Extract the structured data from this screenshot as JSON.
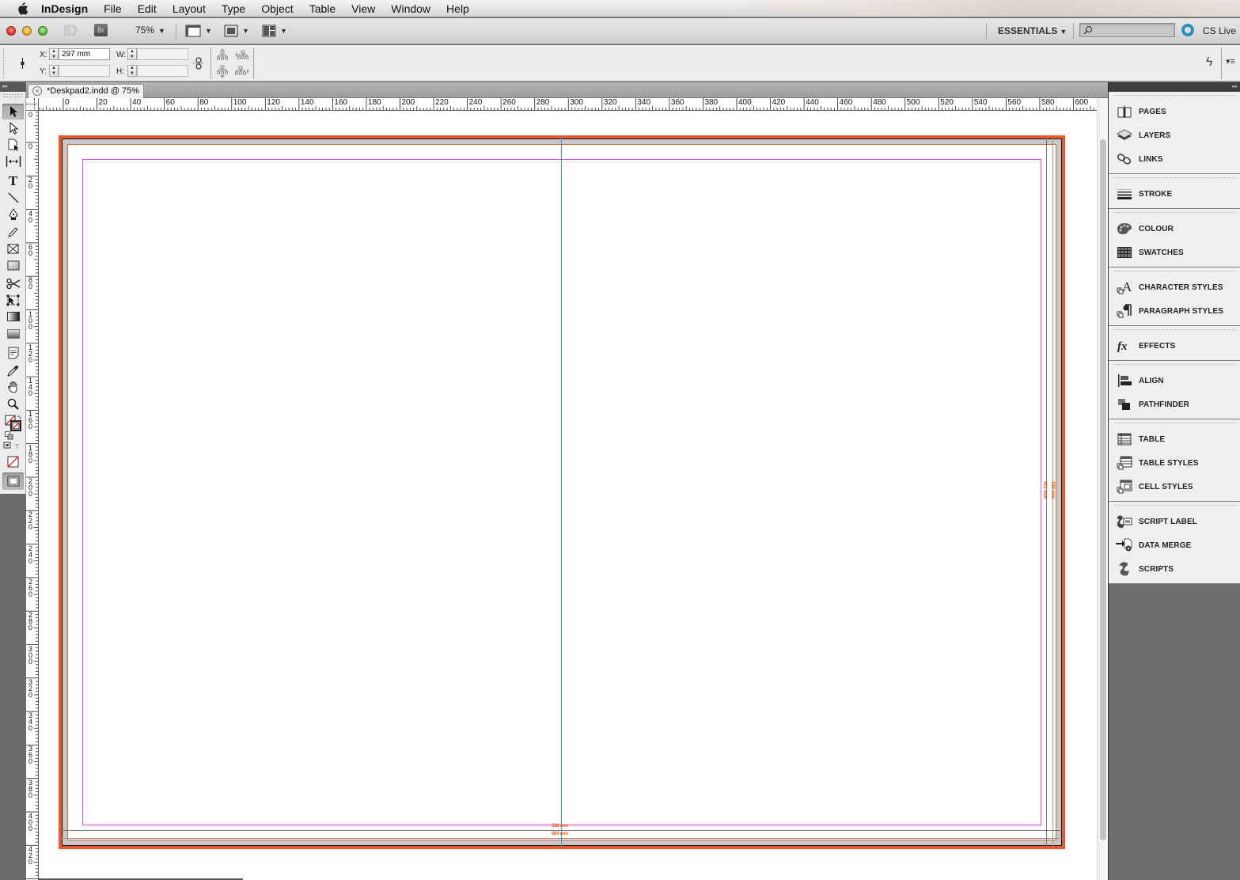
{
  "menubar": {
    "app_name": "InDesign",
    "items": [
      "File",
      "Edit",
      "Layout",
      "Type",
      "Object",
      "Table",
      "View",
      "Window",
      "Help"
    ]
  },
  "appbar": {
    "bridge_label": "Br",
    "zoom_level": "75%",
    "workspace": "ESSENTIALS",
    "search_placeholder": "",
    "cs_live": "CS Live"
  },
  "controlbar": {
    "x_label": "X:",
    "x_value": "297 mm",
    "y_label": "Y:",
    "y_value": "",
    "w_label": "W:",
    "w_value": "",
    "h_label": "H:",
    "h_value": ""
  },
  "document": {
    "tab_title": "*Deskpad2.indd @ 75%",
    "width_label_inner": "568 mm",
    "width_label_outer": "594 mm",
    "height_label_inner": "401 mm",
    "height_label_outer": "420 mm"
  },
  "rulers": {
    "horizontal": [
      "0",
      "20",
      "40",
      "60",
      "80",
      "100",
      "120",
      "140",
      "160",
      "180",
      "200",
      "220",
      "240",
      "260",
      "280",
      "300",
      "320",
      "340",
      "360",
      "380",
      "400",
      "420",
      "440",
      "460",
      "480",
      "500",
      "520",
      "540",
      "560",
      "580",
      "600"
    ],
    "vertical": [
      "0",
      "0",
      "20",
      "40",
      "60",
      "80",
      "100",
      "120",
      "140",
      "160",
      "180",
      "200",
      "220",
      "240",
      "260",
      "280",
      "300",
      "320",
      "340",
      "360",
      "380",
      "400",
      "420"
    ]
  },
  "tools": [
    {
      "name": "selection-tool",
      "selected": true
    },
    {
      "name": "direct-selection-tool"
    },
    {
      "name": "page-tool"
    },
    {
      "name": "gap-tool"
    },
    {
      "name": "type-tool"
    },
    {
      "name": "line-tool"
    },
    {
      "name": "pen-tool"
    },
    {
      "name": "pencil-tool"
    },
    {
      "name": "rectangle-frame-tool"
    },
    {
      "name": "rectangle-tool"
    },
    {
      "name": "scissors-tool"
    },
    {
      "name": "free-transform-tool"
    },
    {
      "name": "gradient-swatch-tool"
    },
    {
      "name": "gradient-feather-tool"
    },
    {
      "name": "note-tool"
    },
    {
      "name": "eyedropper-tool"
    },
    {
      "name": "hand-tool"
    },
    {
      "name": "zoom-tool"
    }
  ],
  "panels": {
    "groups": [
      [
        "PAGES",
        "LAYERS",
        "LINKS"
      ],
      [
        "STROKE"
      ],
      [
        "COLOUR",
        "SWATCHES"
      ],
      [
        "CHARACTER STYLES",
        "PARAGRAPH STYLES"
      ],
      [
        "EFFECTS"
      ],
      [
        "ALIGN",
        "PATHFINDER"
      ],
      [
        "TABLE",
        "TABLE STYLES",
        "CELL STYLES"
      ],
      [
        "SCRIPT LABEL",
        "DATA MERGE",
        "SCRIPTS"
      ]
    ]
  },
  "colors": {
    "bleed": "#e85a34",
    "margin": "#d14ee6",
    "spine_guide": "#4a8fe0",
    "page_edge": "#d06a28",
    "dimension_label": "#ee5a10"
  }
}
